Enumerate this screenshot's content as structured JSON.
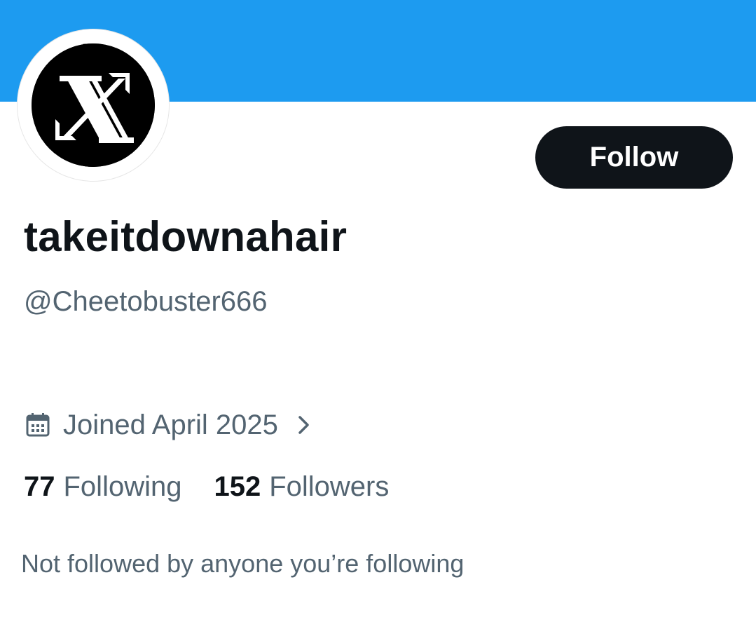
{
  "profile": {
    "display_name": "takeitdownahair",
    "handle": "@Cheetobuster666",
    "avatar_icon": "x-logo-icon",
    "follow_label": "Follow",
    "joined_icon": "calendar-icon",
    "joined_text": "Joined April 2025",
    "following_count": "77",
    "following_label": "Following",
    "followers_count": "152",
    "followers_label": "Followers",
    "mutuals_text": "Not followed by anyone you’re following"
  },
  "colors": {
    "banner": "#1d9bf0",
    "button_bg": "#0f1419",
    "button_text": "#ffffff",
    "primary_text": "#0f1419",
    "secondary_text": "#536471"
  }
}
